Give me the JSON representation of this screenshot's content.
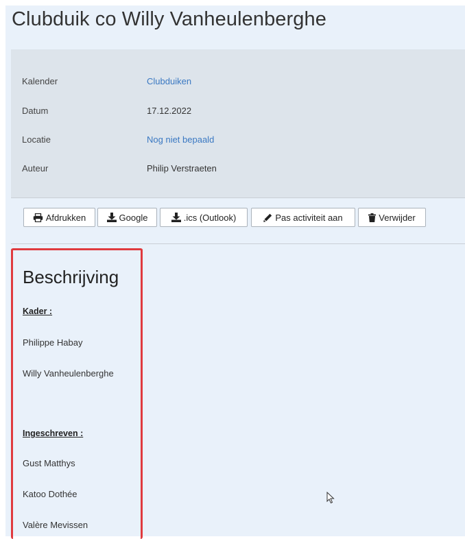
{
  "page": {
    "title": "Clubduik co Willy Vanheulenberghe"
  },
  "details": [
    {
      "label": "Kalender",
      "value": "Clubduiken",
      "link": true
    },
    {
      "label": "Datum",
      "value": "17.12.2022",
      "link": false
    },
    {
      "label": "Locatie",
      "value": "Nog niet bepaald",
      "link": true
    },
    {
      "label": "Auteur",
      "value": "Philip Verstraeten",
      "link": false
    }
  ],
  "toolbar": {
    "print_label": "Afdrukken",
    "google_label": "Google",
    "ics_label": ".ics (Outlook)",
    "edit_label": "Pas activiteit aan",
    "delete_label": "Verwijder"
  },
  "description": {
    "title": "Beschrijving",
    "kader_heading": "Kader :",
    "kader": [
      "Philippe Habay",
      "Willy Vanheulenberghe"
    ],
    "ingeschreven_heading": "Ingeschreven :",
    "ingeschreven": [
      "Gust Matthys",
      "Katoo Dothée",
      "Valère Mevissen"
    ]
  },
  "colors": {
    "link": "#3a78c2",
    "highlight_border": "#e03a3e",
    "page_background": "#e9f1fa",
    "details_background": "#dde4eb"
  }
}
